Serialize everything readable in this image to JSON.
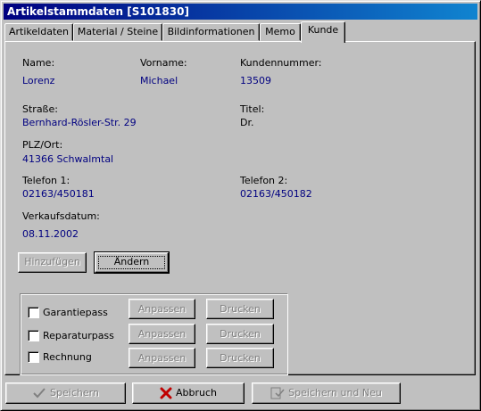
{
  "window": {
    "title": "Artikelstammdaten [S101830]"
  },
  "tabs": [
    {
      "label": "Artikeldaten"
    },
    {
      "label": "Material / Steine"
    },
    {
      "label": "Bildinformationen"
    },
    {
      "label": "Memo"
    },
    {
      "label": "Kunde"
    }
  ],
  "customer": {
    "name_label": "Name:",
    "name": "Lorenz",
    "vorname_label": "Vorname:",
    "vorname": "Michael",
    "kundennummer_label": "Kundennummer:",
    "kundennummer": "13509",
    "strasse_label": "Straße:",
    "strasse": "Bernhard-Rösler-Str. 29",
    "titel_label": "Titel:",
    "titel": "Dr.",
    "plz_label": "PLZ/Ort:",
    "plz": "41366 Schwalmtal",
    "telefon1_label": "Telefon 1:",
    "telefon1": "02163/450181",
    "telefon2_label": "Telefon 2:",
    "telefon2": "02163/450182",
    "verkaufsdatum_label": "Verkaufsdatum:",
    "verkaufsdatum": "08.11.2002"
  },
  "actions": {
    "hinzufuegen": "Hinzufügen",
    "aendern": "Ändern"
  },
  "documents": {
    "rows": [
      {
        "label": "Garantiepass",
        "anpassen": "Anpassen",
        "drucken": "Drucken"
      },
      {
        "label": "Reparaturpass",
        "anpassen": "Anpassen",
        "drucken": "Drucken"
      },
      {
        "label": "Rechnung",
        "anpassen": "Anpassen",
        "drucken": "Drucken"
      }
    ]
  },
  "footer": {
    "speichern": "Speichern",
    "abbruch": "Abbruch",
    "speichern_neu": "Speichern und Neu"
  }
}
